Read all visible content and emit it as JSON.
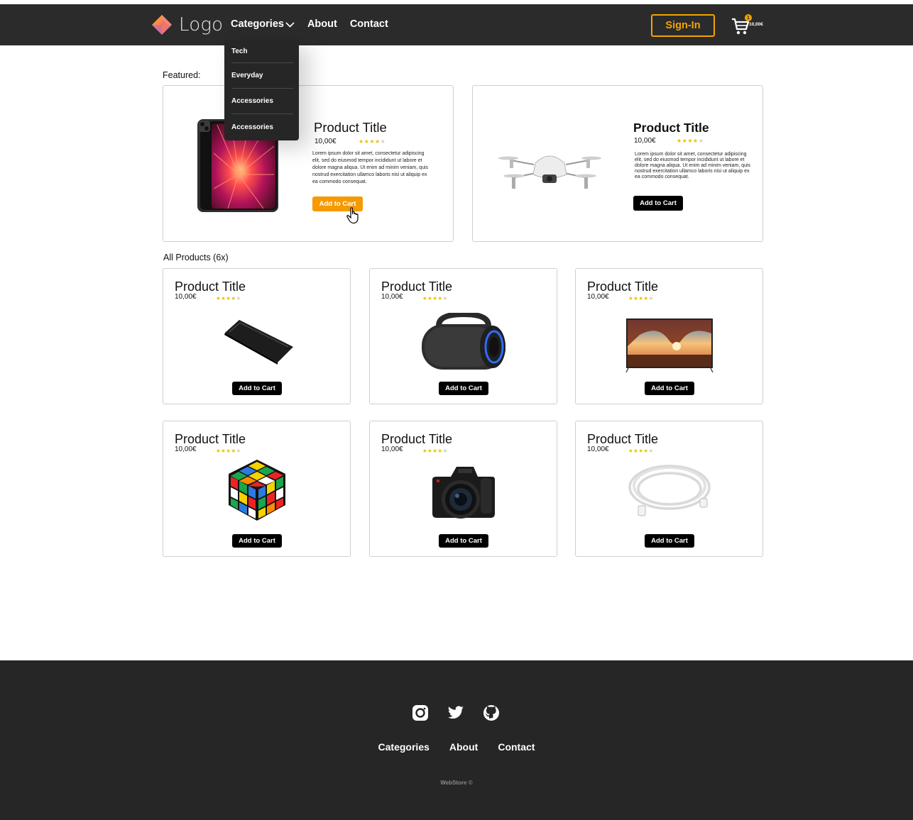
{
  "header": {
    "logo_text": "Logo",
    "nav": [
      {
        "label": "Categories"
      },
      {
        "label": "About"
      },
      {
        "label": "Contact"
      }
    ],
    "signin_label": "Sign-In",
    "cart": {
      "count": "1",
      "total": "10,00€"
    }
  },
  "dropdown": {
    "items": [
      {
        "label": "Tech"
      },
      {
        "label": "Everyday"
      },
      {
        "label": "Accessories"
      },
      {
        "label": "Accessories"
      }
    ]
  },
  "featured": {
    "label": "Featured:",
    "items": [
      {
        "title": "Product Title",
        "price": "10,00€",
        "rating": 4,
        "description": "Lorem ipsum dolor sit amet, consectetur adipiscing elit, sed do eiusmod tempor incididunt ut labore et dolore magna aliqua. Ut enim ad minim veniam, quis nostrud exercitation ullamco laboris nisi ut aliquip ex ea commodo consequat.",
        "button": "Add to Cart",
        "image": "tablet"
      },
      {
        "title": "Product Title",
        "price": "10,00€",
        "rating": 4,
        "description": "Lorem ipsum dolor sit amet, consectetur adipiscing elit, sed do eiusmod tempor incididunt ut labore et dolore magna aliqua. Ut enim ad minim veniam, quis nostrud exercitation ullamco laboris nisi ut aliquip ex ea commodo consequat.",
        "button": "Add to Cart",
        "image": "drone"
      }
    ]
  },
  "all_products": {
    "label": "All Products (6x)",
    "items": [
      {
        "title": "Product Title",
        "price": "10,00€",
        "rating": 4,
        "button": "Add to Cart",
        "image": "power-bank"
      },
      {
        "title": "Product Title",
        "price": "10,00€",
        "rating": 4,
        "button": "Add to Cart",
        "image": "speaker"
      },
      {
        "title": "Product Title",
        "price": "10,00€",
        "rating": 4,
        "button": "Add to Cart",
        "image": "tv"
      },
      {
        "title": "Product Title",
        "price": "10,00€",
        "rating": 4,
        "button": "Add to Cart",
        "image": "rubiks-cube"
      },
      {
        "title": "Product Title",
        "price": "10,00€",
        "rating": 4,
        "button": "Add to Cart",
        "image": "camera"
      },
      {
        "title": "Product Title",
        "price": "10,00€",
        "rating": 4,
        "button": "Add to Cart",
        "image": "cable"
      }
    ]
  },
  "footer": {
    "social": [
      "instagram-icon",
      "twitter-icon",
      "github-icon"
    ],
    "links": [
      {
        "label": "Categories"
      },
      {
        "label": "About"
      },
      {
        "label": "Contact"
      }
    ],
    "copyright": "WebStore ©"
  },
  "colors": {
    "header_bg": "#2b2b2b",
    "accent": "#f5a300",
    "footer_bg": "#262626",
    "star": "#e6c200"
  }
}
